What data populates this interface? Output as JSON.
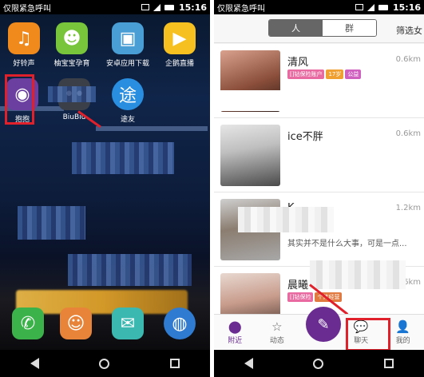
{
  "left_phone": {
    "status": {
      "carrier": "仅限紧急呼叫",
      "time": "15:16"
    },
    "apps": [
      {
        "label": "好铃声",
        "icon": "music-note-icon",
        "color": "#f08a1c"
      },
      {
        "label": "柚宝宝孕育",
        "icon": "fruit-face-icon",
        "color": "#78c43a"
      },
      {
        "label": "安卓应用下载",
        "icon": "shopping-bag-icon",
        "color": "#4a9ed6"
      },
      {
        "label": "企鹅直播",
        "icon": "play-icon",
        "color": "#f5c020"
      },
      {
        "label": "抱抱",
        "icon": "ring-icon",
        "color": "#6a3fa0"
      },
      {
        "label": "BiuBiu",
        "icon": "eyes-icon",
        "color": "#3a3f48"
      },
      {
        "label": "途友",
        "icon": "map-pin-icon",
        "color": "#2a8ee0"
      }
    ],
    "dock": [
      {
        "icon": "phone-icon",
        "color": "#3cb34a"
      },
      {
        "icon": "contacts-icon",
        "color": "#e8843a"
      },
      {
        "icon": "message-icon",
        "color": "#3bb8b0"
      },
      {
        "icon": "browser-icon",
        "color": "#2f7bd1"
      }
    ]
  },
  "right_phone": {
    "status": {
      "carrier": "仅限紧急呼叫",
      "time": "15:16"
    },
    "segment": {
      "people": "人",
      "groups": "群"
    },
    "filter_label": "筛选女",
    "users": [
      {
        "name": "清风",
        "distance": "0.6km",
        "tags": [
          "[]钻保险账户",
          "17岁",
          "公益"
        ],
        "signature": ""
      },
      {
        "name": "ice不胖",
        "distance": "0.6km",
        "tags": [],
        "signature": ""
      },
      {
        "name": "K",
        "distance": "1.2km",
        "tags": [],
        "signature": "其实并不是什么大事，可是一点..."
      },
      {
        "name": "晨曦",
        "distance": "0.6km",
        "tags": [
          "[]钻保险",
          "个体经营"
        ],
        "signature": ""
      }
    ],
    "tabs": [
      {
        "label": "附近",
        "icon": "location-pin-icon"
      },
      {
        "label": "动态",
        "icon": "star-icon"
      },
      {
        "label": "",
        "icon": "compose-icon"
      },
      {
        "label": "聊天",
        "icon": "chat-bubble-icon"
      },
      {
        "label": "我的",
        "icon": "person-icon"
      }
    ],
    "accent": "#6a2c91"
  }
}
